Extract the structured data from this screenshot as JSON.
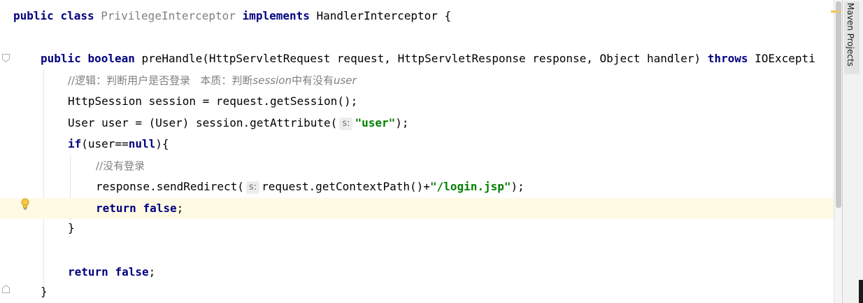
{
  "editor": {
    "lines": {
      "class_decl": {
        "kw_public": "public",
        "kw_class": "class",
        "class_name": "PrivilegeInterceptor",
        "kw_implements": "implements",
        "interface_name": "HandlerInterceptor",
        "brace": " {"
      },
      "method_decl": {
        "kw_public": "public",
        "kw_boolean": "boolean",
        "sig": "preHandle(HttpServletRequest request, HttpServletResponse response, Object handler)",
        "kw_throws": "throws",
        "exception": "IOExcepti"
      },
      "comment1": {
        "prefix": "//逻辑：判断用户是否登录   本质：判断",
        "session_word": "session",
        "middle": "中有没有",
        "user_word": "user"
      },
      "get_session": "HttpSession session = request.getSession();",
      "get_user": {
        "before": "User user = (User) session.getAttribute(",
        "hint": "s:",
        "string": "\"user\"",
        "after": ");"
      },
      "if_line": {
        "kw_if": "if",
        "cond_open": "(user==",
        "kw_null": "null",
        "cond_close": "){"
      },
      "comment2": "//没有登录",
      "redirect": {
        "before": "response.sendRedirect(",
        "hint": "s:",
        "middle": "request.getContextPath()+",
        "string": "\"/login.jsp\"",
        "after": ");"
      },
      "return_inner": {
        "kw_return": "return",
        "kw_false": "false",
        "semi": ";"
      },
      "close_if": "}",
      "return_outer": {
        "kw_return": "return",
        "kw_false": "false",
        "semi": ";"
      },
      "close_method": "}"
    }
  },
  "side_panel": {
    "maven_tab_label": "Maven Projects"
  },
  "colors": {
    "keyword": "#000080",
    "string": "#008000",
    "comment": "#808080",
    "current_line": "#fffae3"
  }
}
